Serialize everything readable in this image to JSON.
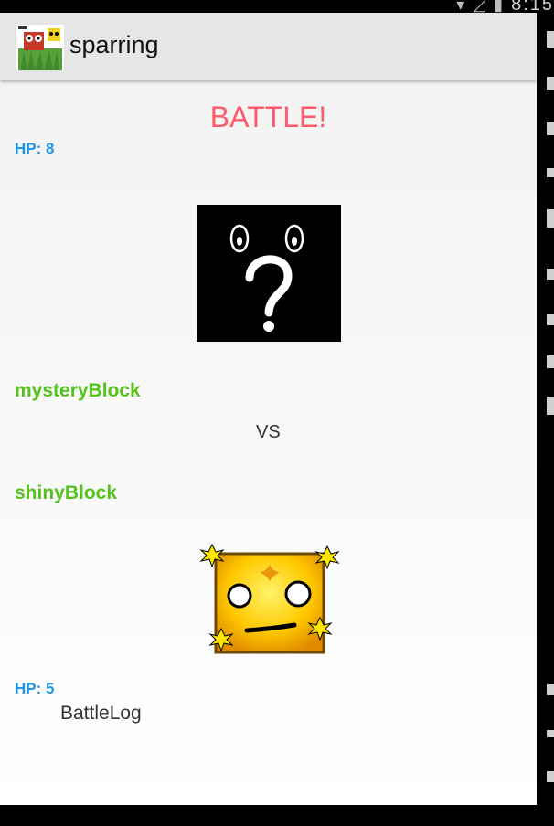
{
  "app": {
    "title": "sparring"
  },
  "battle": {
    "title": "BATTLE!",
    "player1": {
      "hp_label": "HP: 8",
      "name": "mysteryBlock",
      "image": "mystery-block-icon"
    },
    "vs_label": "VS",
    "player2": {
      "hp_label": "HP: 5",
      "name": "shinyBlock",
      "image": "shiny-block-icon"
    },
    "log_label": "BattleLog"
  },
  "status_bar": {
    "time": "8:15"
  },
  "colors": {
    "title": "#ff5a6b",
    "hp": "#1e96e6",
    "name": "#55c21e"
  }
}
